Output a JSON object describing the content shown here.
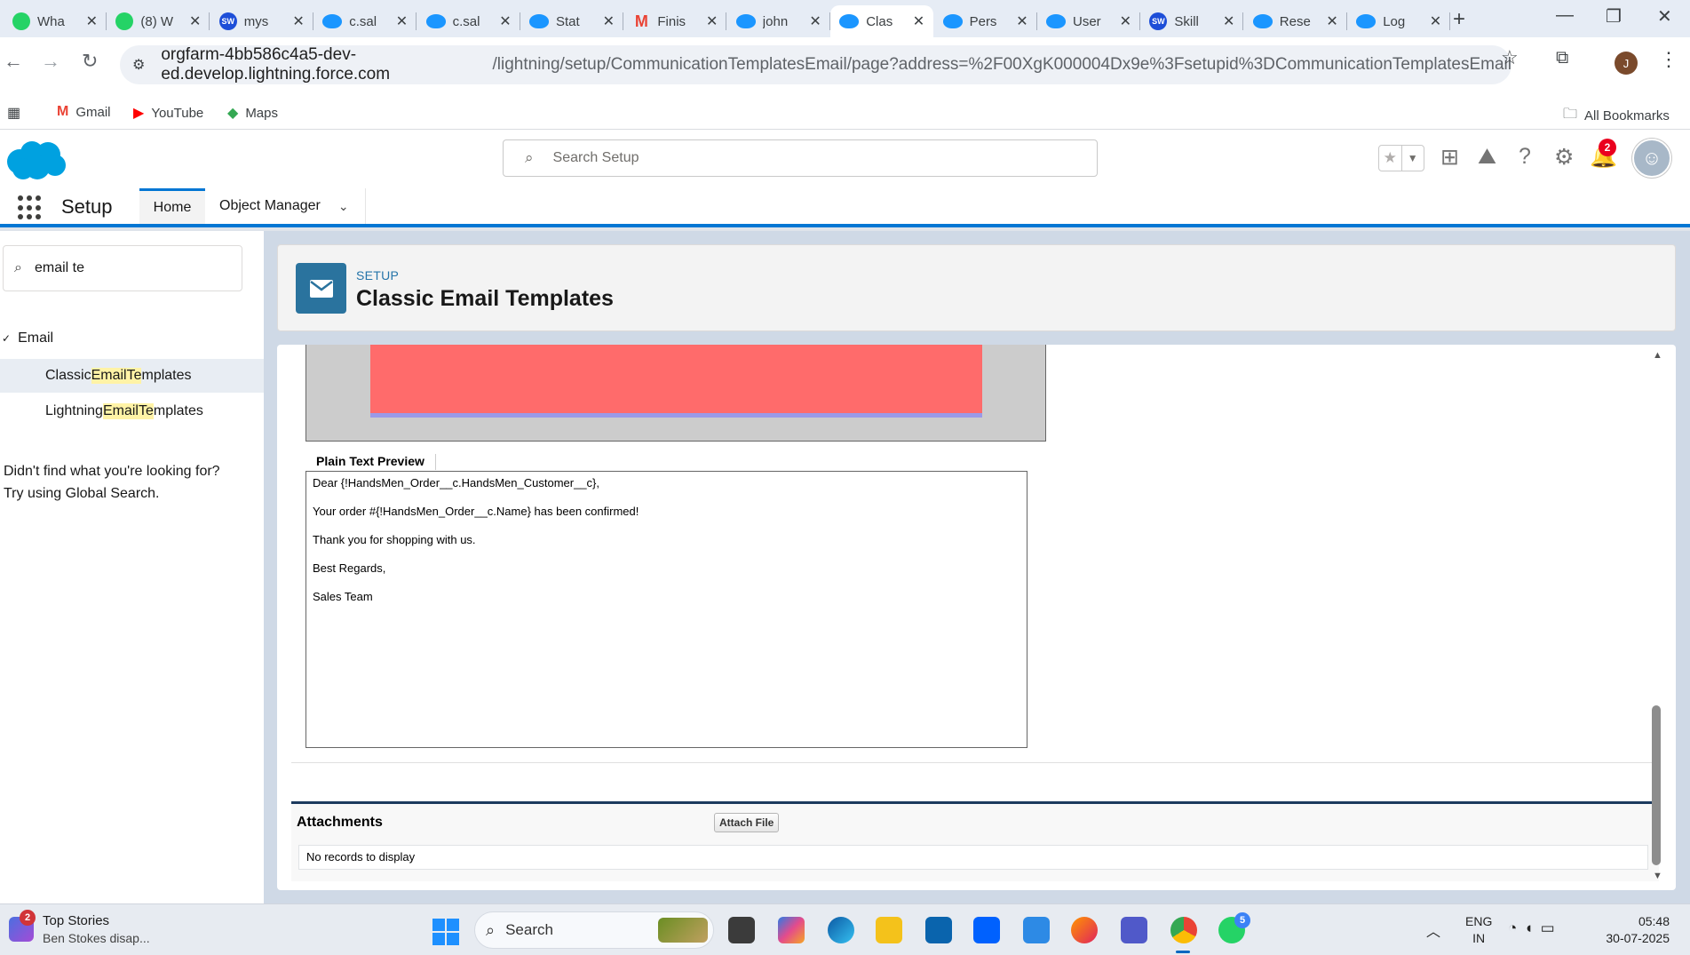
{
  "browser": {
    "tabs": [
      {
        "label": "Wha",
        "icon": "whatsapp-icon"
      },
      {
        "label": "(8) W",
        "icon": "whatsapp-icon"
      },
      {
        "label": "mys",
        "icon": "sw-icon"
      },
      {
        "label": "c.sal",
        "icon": "salesforce-cloud-icon"
      },
      {
        "label": "c.sal",
        "icon": "salesforce-cloud-icon"
      },
      {
        "label": "Stat",
        "icon": "salesforce-cloud-icon"
      },
      {
        "label": "Finis",
        "icon": "gmail-icon"
      },
      {
        "label": "john",
        "icon": "salesforce-cloud-icon"
      },
      {
        "label": "Clas",
        "icon": "salesforce-cloud-icon",
        "active": true
      },
      {
        "label": "Pers",
        "icon": "salesforce-cloud-icon"
      },
      {
        "label": "User",
        "icon": "salesforce-cloud-icon"
      },
      {
        "label": "Skill",
        "icon": "sw-icon"
      },
      {
        "label": "Rese",
        "icon": "salesforce-cloud-icon"
      },
      {
        "label": "Log",
        "icon": "salesforce-cloud-icon"
      }
    ],
    "url_host": "orgfarm-4bb586c4a5-dev-ed.develop.lightning.force.com",
    "url_path": "/lightning/setup/CommunicationTemplatesEmail/page?address=%2F00XgK000004Dx9e%3Fsetupid%3DCommunicationTemplatesEmail",
    "profile_initial": "J",
    "bookmarks": [
      {
        "label": "Gmail",
        "icon": "gmail-icon"
      },
      {
        "label": "YouTube",
        "icon": "youtube-icon"
      },
      {
        "label": "Maps",
        "icon": "maps-icon"
      }
    ],
    "all_bookmarks_label": "All Bookmarks"
  },
  "sf_header": {
    "search_placeholder": "Search Setup",
    "notification_count": "2"
  },
  "setup_nav": {
    "app_title": "Setup",
    "home_tab": "Home",
    "object_manager_tab": "Object Manager"
  },
  "sidebar": {
    "search_value": "email te",
    "group_label": "Email",
    "items": [
      {
        "pre": "Classic ",
        "hl1": "Email",
        "mid": " ",
        "hl2": "Te",
        "post": "mplates",
        "selected": true
      },
      {
        "pre": "Lightning ",
        "hl1": "Email",
        "mid": " ",
        "hl2": "Te",
        "post": "mplates",
        "selected": false
      }
    ],
    "help_line1": "Didn't find what you're looking for?",
    "help_line2": "Try using Global Search."
  },
  "page_header": {
    "eyebrow": "SETUP",
    "title": "Classic Email Templates"
  },
  "plain_text_preview": {
    "tab_label": "Plain Text Preview",
    "lines": [
      "Dear {!HandsMen_Order__c.HandsMen_Customer__c},",
      "Your order #{!HandsMen_Order__c.Name} has been confirmed!",
      "Thank you for shopping with us.",
      "Best Regards,",
      "Sales Team"
    ]
  },
  "attachments": {
    "title": "Attachments",
    "attach_button": "Attach File",
    "empty_text": "No records to display"
  },
  "taskbar": {
    "news_badge": "2",
    "news_title": "Top Stories",
    "news_subtitle": "Ben Stokes disap...",
    "search_label": "Search",
    "whatsapp_badge": "5",
    "lang_line1": "ENG",
    "lang_line2": "IN",
    "time": "05:48",
    "date": "30-07-2025"
  },
  "colors": {
    "salesforce_blue": "#0176d3",
    "template_icon_bg": "#2a739e",
    "preview_red": "#ff6b6b",
    "notification_red": "#ea001e"
  }
}
